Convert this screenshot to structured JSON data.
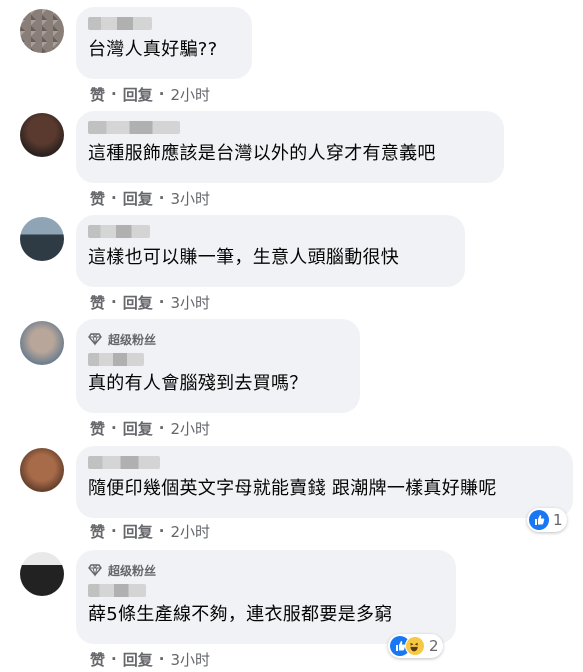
{
  "actions": {
    "like": "赞",
    "reply": "回复",
    "separator": "·"
  },
  "badge_label": "超级粉丝",
  "comments": [
    {
      "text": "台灣人真好騙??",
      "time": "2小时"
    },
    {
      "text": "這種服飾應該是台灣以外的人穿才有意義吧",
      "time": "3小时"
    },
    {
      "text": "這樣也可以賺一筆，生意人頭腦動很快",
      "time": "3小时"
    },
    {
      "text": "真的有人會腦殘到去買嗎？",
      "time": "2小时",
      "badge": true
    },
    {
      "text": "隨便印幾個英文字母就能賣錢 跟潮牌一樣真好賺呢",
      "time": "2小时",
      "reactions": {
        "count": "1",
        "icons": [
          "like-icon"
        ]
      }
    },
    {
      "text": "薛5條生產線不夠，連衣服都要是多窮",
      "time": "3小时",
      "badge": true,
      "reactions": {
        "count": "2",
        "icons": [
          "like-icon",
          "haha-icon"
        ]
      }
    }
  ],
  "colors": {
    "like_blue": "#1877f2",
    "bubble_gray": "#f0f2f5",
    "meta_gray": "#65676b"
  }
}
